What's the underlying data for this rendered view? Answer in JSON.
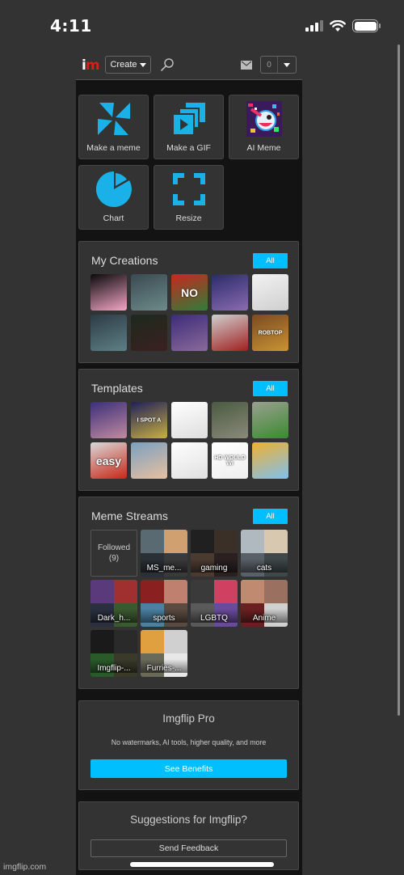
{
  "status_bar": {
    "time": "4:11"
  },
  "header": {
    "logo_i": "i",
    "logo_m": "m",
    "create_label": "Create",
    "notification_count": "0",
    "icons": [
      "search-icon",
      "mail-icon",
      "chevron-down-icon"
    ]
  },
  "tools": [
    {
      "label": "Make a meme",
      "icon": "pinwheel-icon"
    },
    {
      "label": "Make a GIF",
      "icon": "gif-stack-icon"
    },
    {
      "label": "AI Meme",
      "icon": "ai-robot-icon"
    },
    {
      "label": "Chart",
      "icon": "pie-chart-icon"
    },
    {
      "label": "Resize",
      "icon": "resize-corners-icon"
    }
  ],
  "my_creations": {
    "title": "My Creations",
    "all_label": "All",
    "thumbs": [
      {
        "caption": "",
        "colors": [
          "#0a0a0a",
          "#f4a6c6"
        ]
      },
      {
        "caption": "",
        "colors": [
          "#3a4a52",
          "#6d8a8a"
        ]
      },
      {
        "caption": "NO",
        "colors": [
          "#c8281e",
          "#2f7d3a"
        ]
      },
      {
        "caption": "",
        "colors": [
          "#2a2b6a",
          "#8a6bb0"
        ]
      },
      {
        "caption": "",
        "colors": [
          "#f2f2f2",
          "#cfcfcf"
        ]
      },
      {
        "caption": "",
        "colors": [
          "#2d3c45",
          "#5e7f86"
        ]
      },
      {
        "caption": "",
        "colors": [
          "#1d2a1d",
          "#3b2020"
        ]
      },
      {
        "caption": "",
        "colors": [
          "#3c2c7a",
          "#8a6a9a"
        ]
      },
      {
        "caption": "",
        "colors": [
          "#cfcfcf",
          "#a02020"
        ]
      },
      {
        "caption": "ROBTOP",
        "colors": [
          "#7a4a22",
          "#c89434"
        ]
      }
    ]
  },
  "templates": {
    "title": "Templates",
    "all_label": "All",
    "thumbs": [
      {
        "caption": "",
        "colors": [
          "#3b2f7a",
          "#c08aa0"
        ]
      },
      {
        "caption": "I SPOT A",
        "colors": [
          "#20205a",
          "#c8b040"
        ]
      },
      {
        "caption": "",
        "colors": [
          "#ffffff",
          "#dddddd"
        ]
      },
      {
        "caption": "",
        "colors": [
          "#4a5a40",
          "#8a8a7a"
        ]
      },
      {
        "caption": "",
        "colors": [
          "#9aa090",
          "#3a8a30"
        ]
      },
      {
        "caption": "easy",
        "colors": [
          "#d8d8d8",
          "#c82818"
        ]
      },
      {
        "caption": "",
        "colors": [
          "#7aa0c0",
          "#e8c0a0"
        ]
      },
      {
        "caption": "",
        "colors": [
          "#ffffff",
          "#e0e0e0"
        ]
      },
      {
        "caption": "HD WOULD WI",
        "colors": [
          "#ffffff",
          "#eeeeee"
        ]
      },
      {
        "caption": "",
        "colors": [
          "#f0b030",
          "#80c0f0"
        ]
      }
    ]
  },
  "meme_streams": {
    "title": "Meme Streams",
    "all_label": "All",
    "followed_label": "Followed",
    "followed_count": "(9)",
    "streams": [
      {
        "label": "MS_me...",
        "colors": [
          "#5a6a72",
          "#d0a070",
          "#2a3036",
          "#3a3a3a"
        ]
      },
      {
        "label": "gaming",
        "colors": [
          "#202020",
          "#3a3028",
          "#4a3a30",
          "#2a2020"
        ]
      },
      {
        "label": "cats",
        "colors": [
          "#b0b8c0",
          "#d8c8b0",
          "#5a6068",
          "#40484a"
        ]
      },
      {
        "label": "Dark_h...",
        "colors": [
          "#5a3a7a",
          "#a03030",
          "#2a3040",
          "#3a5a30"
        ]
      },
      {
        "label": "sports",
        "colors": [
          "#8a2020",
          "#c08070",
          "#4a80a0",
          "#5a4a40"
        ]
      },
      {
        "label": "LGBTQ",
        "colors": [
          "#3a3a3a",
          "#d04060",
          "#5a5a5a",
          "#6a4a9a"
        ]
      },
      {
        "label": "Anime",
        "colors": [
          "#c08a70",
          "#9a7060",
          "#6a2020",
          "#d0d0d0"
        ]
      },
      {
        "label": "Imgflip-...",
        "colors": [
          "#1a1a1a",
          "#2a2a2a",
          "#2a5a2a",
          "#3a3a2a"
        ]
      },
      {
        "label": "Furries-...",
        "colors": [
          "#e0a040",
          "#d0d0d0",
          "#6a6a5a",
          "#e8e8e8"
        ]
      }
    ]
  },
  "pro": {
    "title": "Imgflip Pro",
    "description": "No watermarks, AI tools, higher quality, and more",
    "button_label": "See Benefits"
  },
  "feedback": {
    "title": "Suggestions for Imgflip?",
    "button_label": "Send Feedback"
  },
  "footer": {
    "site": "imgflip.com"
  },
  "colors": {
    "accent": "#00bfff",
    "logo_red": "#e21a1a",
    "panel_bg": "#333333",
    "page_bg": "#131313"
  }
}
